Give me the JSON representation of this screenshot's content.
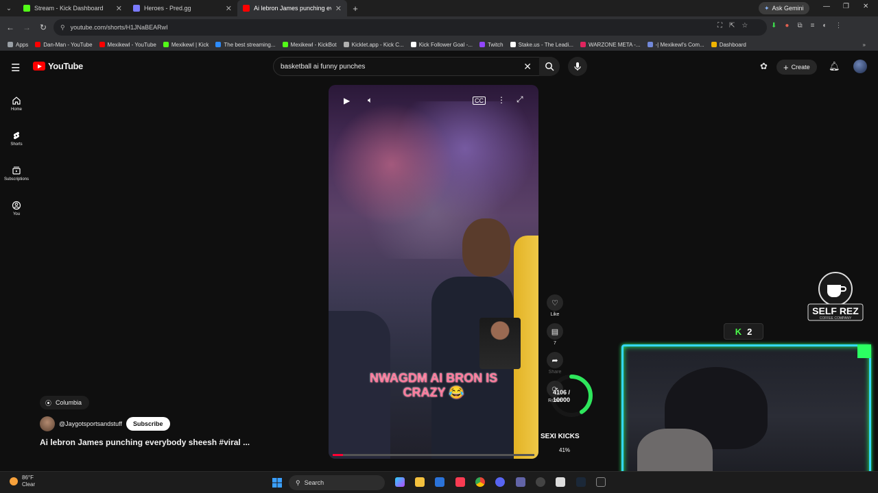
{
  "browser": {
    "tabs": [
      {
        "title": "Stream - Kick Dashboard",
        "color": "#53fc18"
      },
      {
        "title": "Heroes - Pred.gg",
        "color": "#7b7bff"
      },
      {
        "title": "Ai lebron James punching ever",
        "color": "#ff0000"
      }
    ],
    "ask_gemini": "Ask Gemini",
    "url": "youtube.com/shorts/H1JNaBEARwI",
    "bookmarks": [
      {
        "label": "Apps",
        "color": "#9aa0a6"
      },
      {
        "label": "Dan-Man - YouTube",
        "color": "#ff0000"
      },
      {
        "label": "Mexikewl - YouTube",
        "color": "#ff0000"
      },
      {
        "label": "Mexikewl | Kick",
        "color": "#53fc18"
      },
      {
        "label": "The best streaming...",
        "color": "#2d8cff"
      },
      {
        "label": "Mexikewl - KickBot",
        "color": "#53fc18"
      },
      {
        "label": "Kicklet.app - Kick C...",
        "color": "#b0b0b0"
      },
      {
        "label": "Kick Follower Goal -...",
        "color": "#ffffff"
      },
      {
        "label": "Twitch",
        "color": "#9146ff"
      },
      {
        "label": "Stake.us - The Leadi...",
        "color": "#ffffff"
      },
      {
        "label": "WARZONE META -...",
        "color": "#e0245e"
      },
      {
        "label": "-| Mexikewl's Com...",
        "color": "#7289da"
      },
      {
        "label": "Dashboard",
        "color": "#f0b400"
      }
    ]
  },
  "youtube": {
    "logo_text": "YouTube",
    "search_query": "basketball ai funny punches",
    "create_label": "Create",
    "sidenav": [
      {
        "label": "Home",
        "icon": "home-icon"
      },
      {
        "label": "Shorts",
        "icon": "shorts-icon"
      },
      {
        "label": "Subscriptions",
        "icon": "subscriptions-icon"
      },
      {
        "label": "You",
        "icon": "you-icon"
      }
    ]
  },
  "short": {
    "caption_line1": "NWAGDM AI BRON IS",
    "caption_line2": "CRAZY 😂",
    "progress_fraction": 0.05,
    "actions": [
      {
        "label": "Like",
        "icon": "heart-icon"
      },
      {
        "label": "7",
        "icon": "comment-icon"
      },
      {
        "label": "Share",
        "icon": "share-icon"
      },
      {
        "label": "Remix",
        "icon": "remix-icon"
      }
    ],
    "location": "Columbia",
    "channel": "@Jaygotsportsandstuff",
    "subscribe_label": "Subscribe",
    "title": "Ai lebron James punching everybody sheesh #viral ..."
  },
  "overlay": {
    "goal_text_line1": "4106 /",
    "goal_text_line2": "10000",
    "goal_fraction": 0.41,
    "sexi_kicks": "SEXI KICKS",
    "sexi_pct": "41%",
    "kick_count": "2",
    "brand": "SELF REZ",
    "brand_sub": "COFFEE COMPANY"
  },
  "taskbar": {
    "temp": "86°F",
    "condition": "Clear",
    "search_label": "Search"
  }
}
